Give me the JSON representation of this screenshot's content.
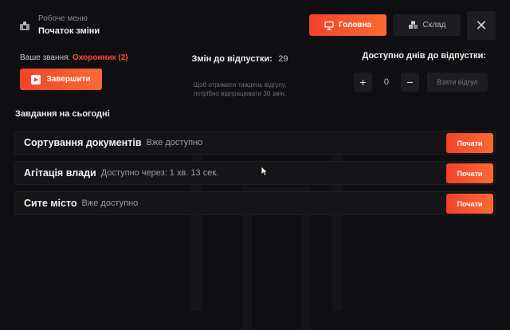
{
  "header": {
    "menu_subtitle": "Робоче меню",
    "menu_title": "Початок зміни"
  },
  "nav": {
    "home_label": "Головна",
    "stock_label": "Склад",
    "close_label": "✕"
  },
  "rank": {
    "label": "Ваше звання:",
    "value": "Охоронник (2)"
  },
  "finish_button": "Завершити",
  "shifts": {
    "label": "Змін до відпустки:",
    "count": "29",
    "hint_line1": "Щоб отримати тиждень відгулу,",
    "hint_line2": "потрібно відпрацювати 30 змін."
  },
  "vacation": {
    "label": "Доступно днів до відпустки:",
    "plus": "+",
    "days": "0",
    "minus": "−",
    "take_button": "Взяти відгул"
  },
  "tasks": {
    "title": "Завдання на сьогодні",
    "items": [
      {
        "name": "Сортування документів",
        "status": "Вже доступно",
        "button": "Почати"
      },
      {
        "name": "Агітація влади",
        "status": "Доступно через: 1 хв. 13 сек.",
        "button": "Почати"
      },
      {
        "name": "Сите місто",
        "status": "Вже доступно",
        "button": "Почати"
      }
    ]
  },
  "colors": {
    "accent": "#f5492c",
    "background": "#0f0f12",
    "panel": "#151518"
  },
  "icons": [
    "menu-icon",
    "presentation-icon",
    "boxes-icon",
    "close-icon",
    "play-icon",
    "cursor-icon"
  ]
}
